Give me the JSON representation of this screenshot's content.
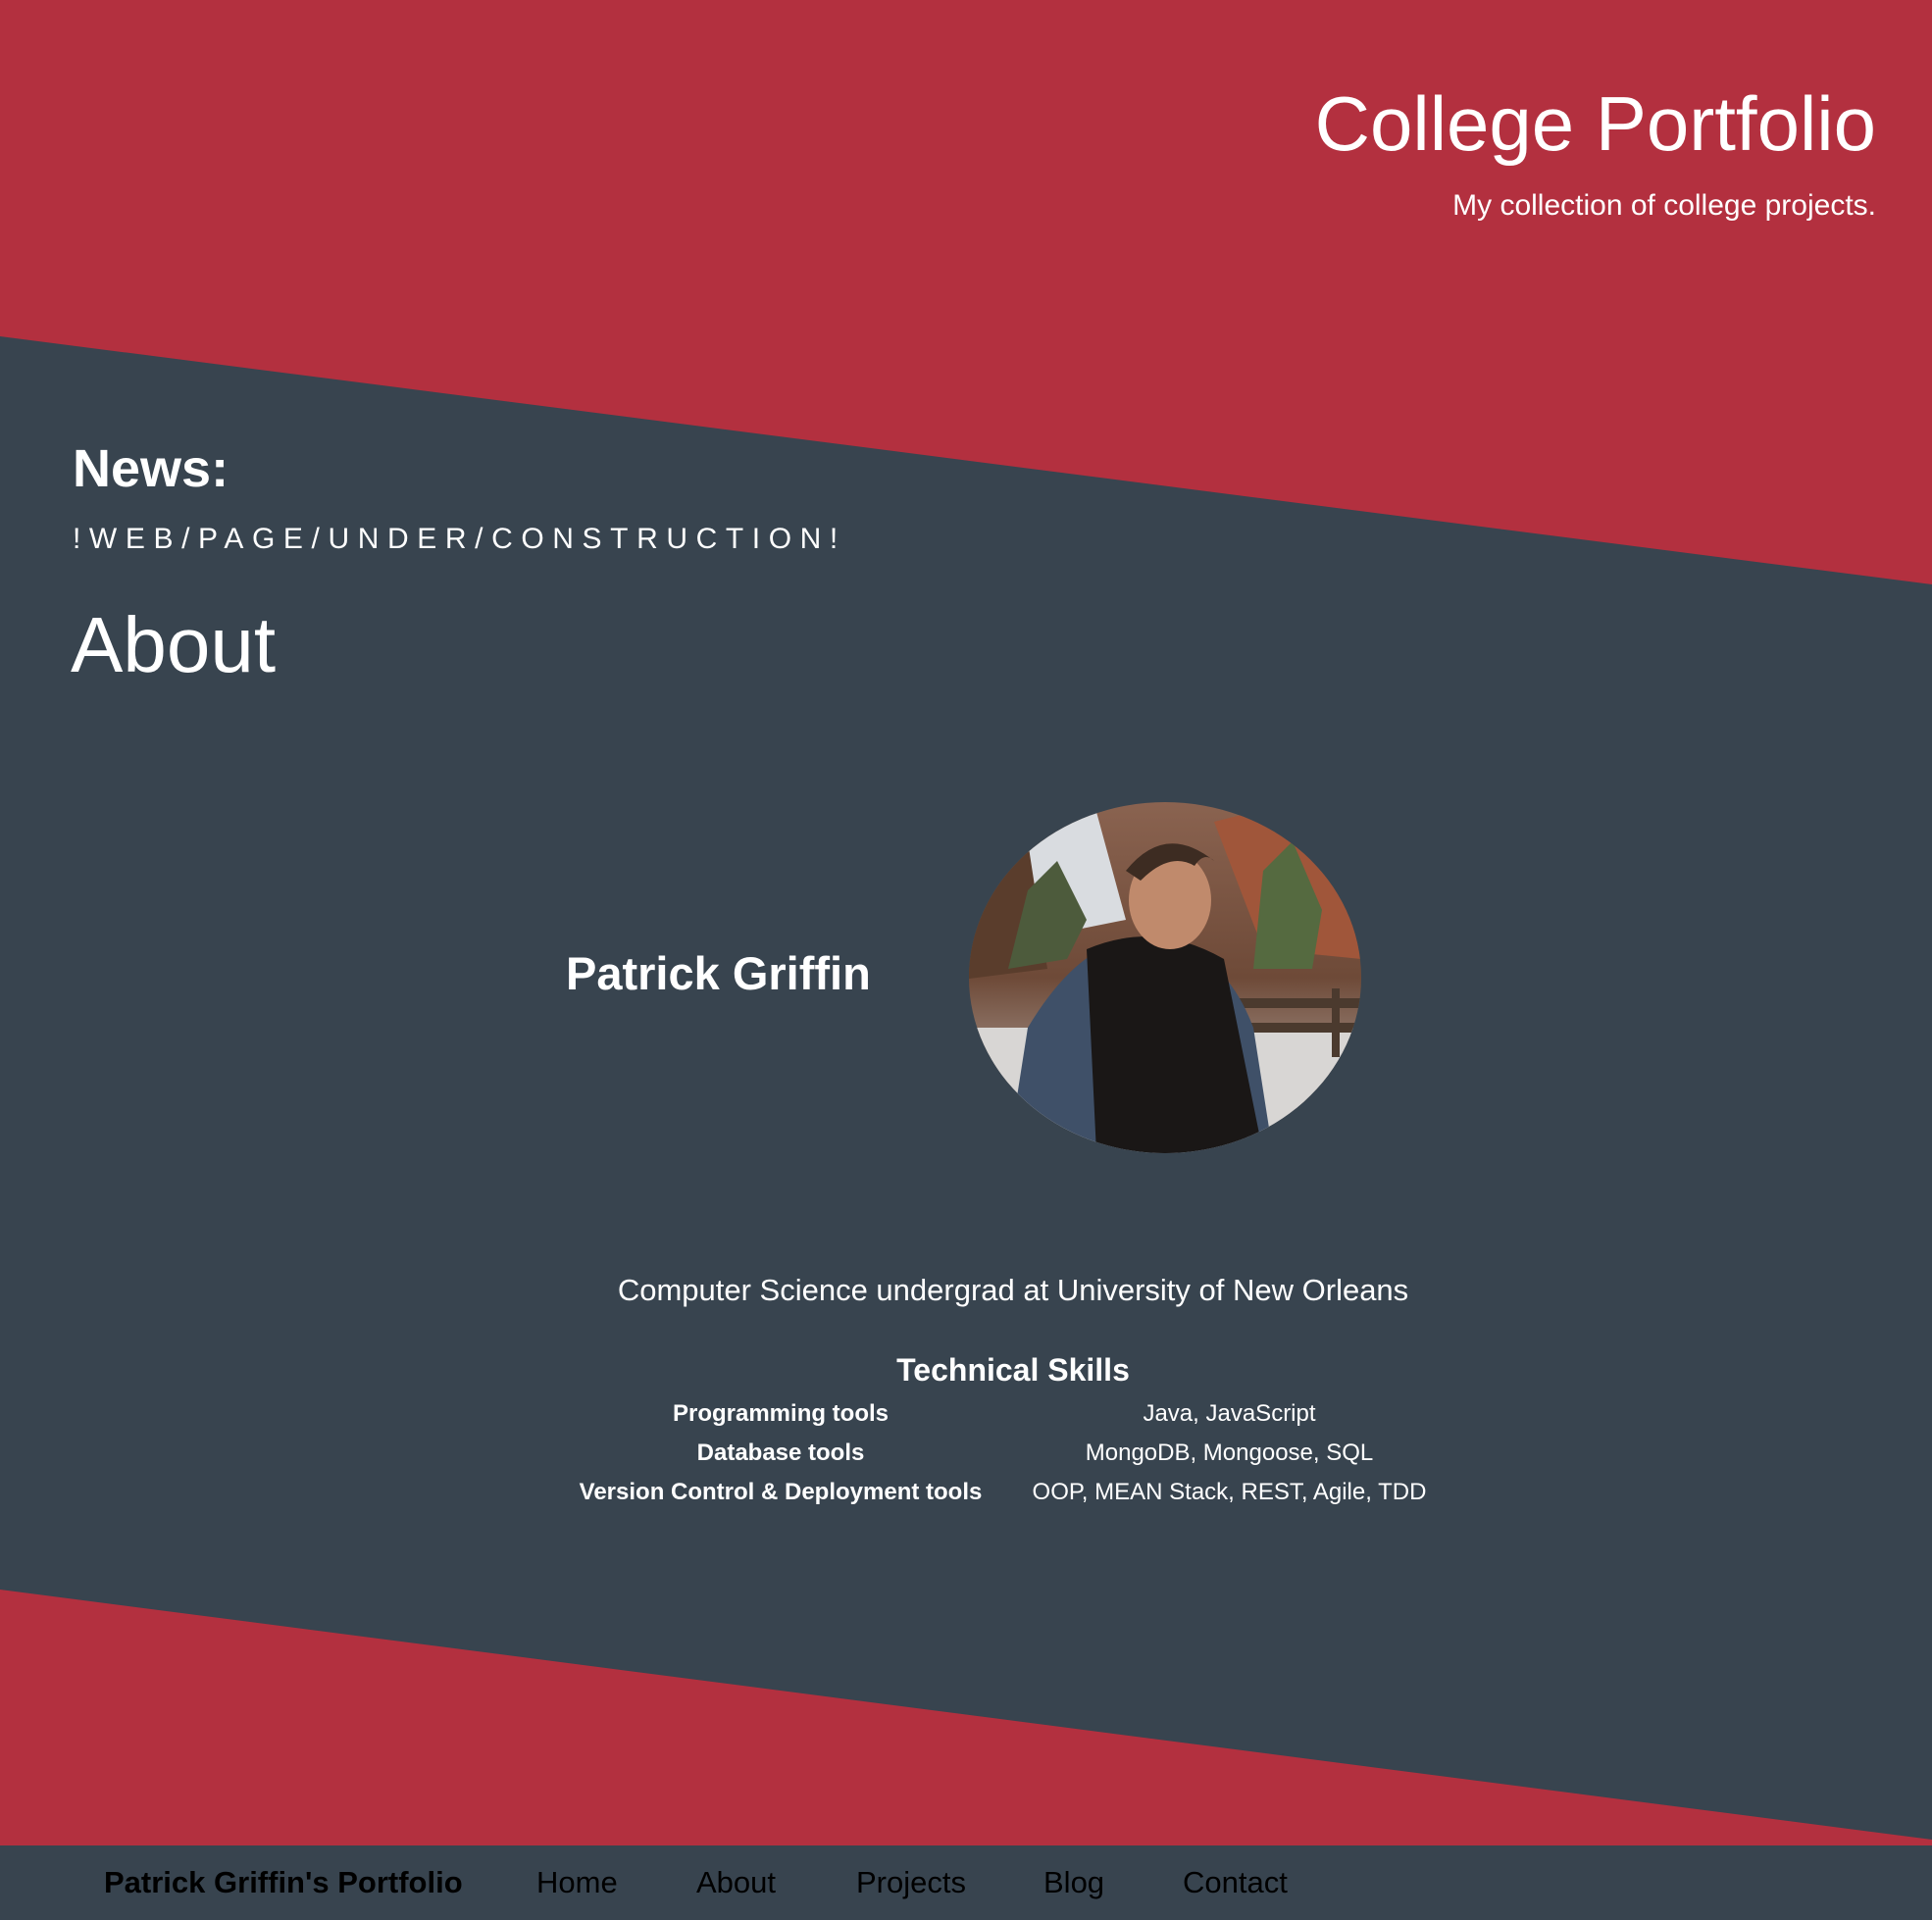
{
  "header": {
    "title": "College Portfolio",
    "subtitle": "My collection of college projects."
  },
  "news": {
    "heading": "News:",
    "text": "!WEB/PAGE/UNDER/CONSTRUCTION!"
  },
  "about": {
    "heading": "About",
    "name": "Patrick Griffin",
    "photo_icon": "profile-photo",
    "bio": "Computer Science undergrad at University of New Orleans",
    "skills_heading": "Technical Skills",
    "skills": [
      {
        "category": "Programming tools",
        "value": "Java, JavaScript"
      },
      {
        "category": "Database tools",
        "value": "MongoDB, Mongoose, SQL"
      },
      {
        "category": "Version Control & Deployment tools",
        "value": "OOP, MEAN Stack, REST, Agile, TDD"
      }
    ]
  },
  "nav": {
    "brand": "Patrick Griffin's Portfolio",
    "items": [
      {
        "label": "Home"
      },
      {
        "label": "About"
      },
      {
        "label": "Projects"
      },
      {
        "label": "Blog"
      },
      {
        "label": "Contact"
      }
    ]
  },
  "colors": {
    "accent_red": "#b3303f",
    "slate": "#38444f",
    "text": "#ffffff",
    "nav_text": "#000000"
  }
}
